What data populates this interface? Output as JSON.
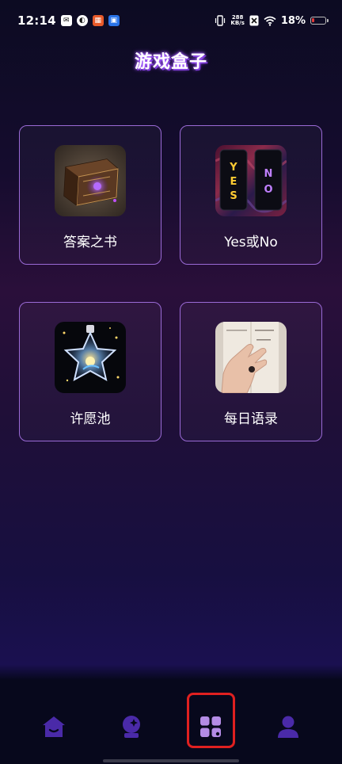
{
  "status_bar": {
    "time": "12:14",
    "net_speed_value": "288",
    "net_speed_unit": "KB/s",
    "battery": "18%"
  },
  "header": {
    "title": "游戏盒子"
  },
  "cards": [
    {
      "label": "答案之书",
      "icon": "magic-book-icon"
    },
    {
      "label": "Yes或No",
      "icon": "yes-no-cards-icon"
    },
    {
      "label": "许愿池",
      "icon": "wish-bottle-icon"
    },
    {
      "label": "每日语录",
      "icon": "daily-quote-book-icon"
    }
  ],
  "bottom_nav": {
    "items": [
      {
        "icon": "home-icon",
        "active": false
      },
      {
        "icon": "crystal-ball-icon",
        "active": false
      },
      {
        "icon": "grid-apps-icon",
        "active": true
      },
      {
        "icon": "user-profile-icon",
        "active": false
      }
    ]
  },
  "colors": {
    "card_border": "#9a6ad6",
    "nav_inactive": "#4a2aa8",
    "nav_active": "#b48ce6",
    "highlight": "#e02020"
  }
}
